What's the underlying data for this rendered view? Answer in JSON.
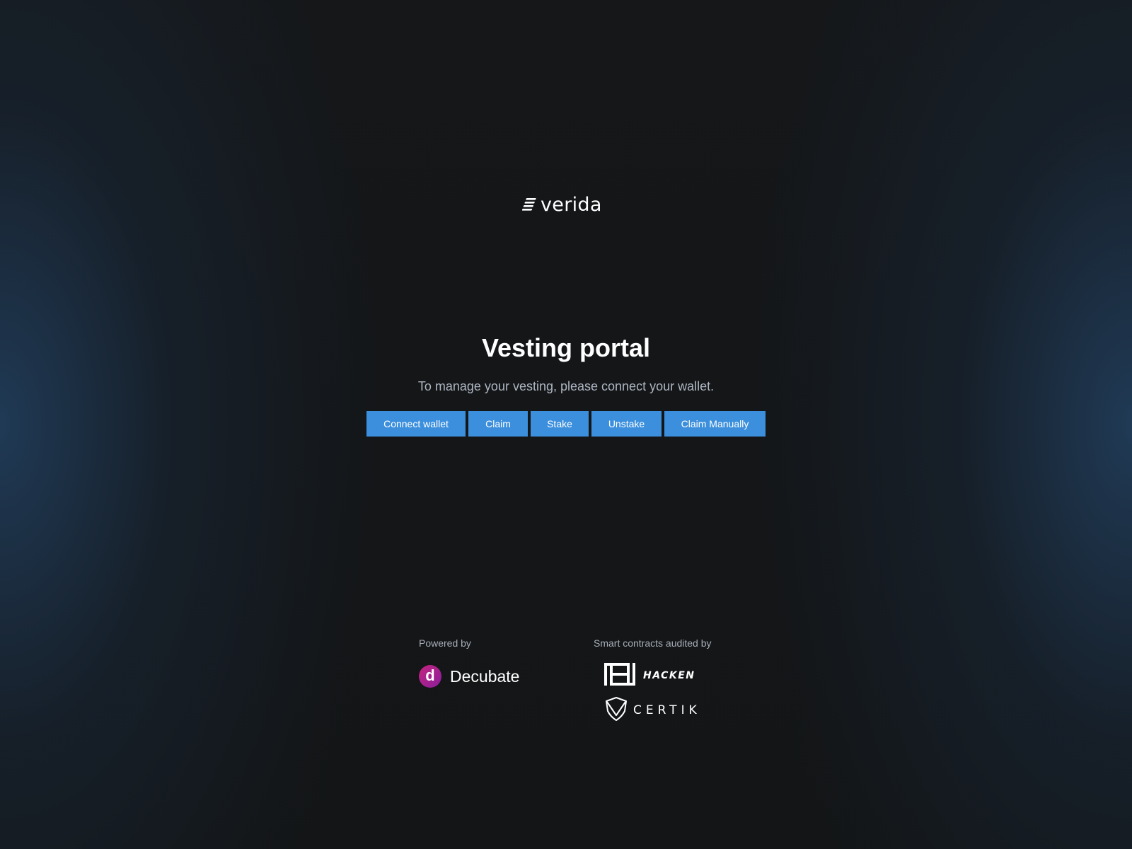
{
  "brand": {
    "logo_text": "verida",
    "logo_icon": "verida-stripes-icon"
  },
  "hero": {
    "title": "Vesting portal",
    "subtitle": "To manage your vesting, please connect your wallet."
  },
  "actions": {
    "connect_wallet": "Connect wallet",
    "claim": "Claim",
    "stake": "Stake",
    "unstake": "Unstake",
    "claim_manually": "Claim Manually"
  },
  "footer": {
    "powered_by_label": "Powered by",
    "audited_by_label": "Smart contracts audited by",
    "decubate": {
      "mark_letter": "d",
      "name": "Decubate",
      "icon": "decubate-logo-icon"
    },
    "hacken": {
      "name": "HACKEN",
      "icon": "hacken-logo-icon"
    },
    "certik": {
      "name": "CERTIK",
      "icon": "certik-shield-icon"
    }
  },
  "colors": {
    "button": "#3b8fdd",
    "subtitle": "#aeb6c2",
    "decubate_gradient_start": "#c5247f",
    "decubate_gradient_end": "#8a1e9c"
  }
}
